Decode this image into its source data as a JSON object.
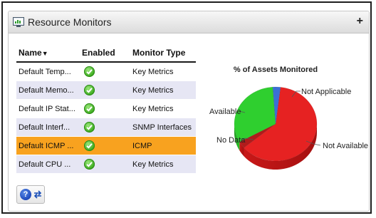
{
  "panel": {
    "title": "Resource Monitors",
    "expand_label": "+"
  },
  "table": {
    "columns": {
      "name": "Name",
      "enabled": "Enabled",
      "type": "Monitor Type"
    },
    "rows": [
      {
        "name": "Default Temp...",
        "enabled": true,
        "type": "Key Metrics",
        "state": "normal"
      },
      {
        "name": "Default Memo...",
        "enabled": true,
        "type": "Key Metrics",
        "state": "alt"
      },
      {
        "name": "Default IP Stat...",
        "enabled": true,
        "type": "Key Metrics",
        "state": "normal"
      },
      {
        "name": "Default Interf...",
        "enabled": true,
        "type": "SNMP Interfaces",
        "state": "alt"
      },
      {
        "name": "Default ICMP ...",
        "enabled": true,
        "type": "ICMP",
        "state": "selected"
      },
      {
        "name": "Default CPU ...",
        "enabled": true,
        "type": "Key Metrics",
        "state": "alt"
      }
    ]
  },
  "toolbar": {
    "help_label": "?"
  },
  "chart": {
    "title": "% of Assets Monitored",
    "labels": {
      "not_applicable": "Not Applicable",
      "available": "Available",
      "no_data": "No Data",
      "not_available": "Not Available"
    }
  },
  "chart_data": {
    "type": "pie",
    "title": "% of Assets Monitored",
    "slices": [
      {
        "label": "Not Available",
        "value": 62,
        "color": "#e62222"
      },
      {
        "label": "No Data",
        "value": 3,
        "color": "#b01b1b"
      },
      {
        "label": "Available",
        "value": 32,
        "color": "#2fcf2f"
      },
      {
        "label": "Not Applicable",
        "value": 3,
        "color": "#3b6fd6"
      }
    ]
  },
  "colors": {
    "selected_row": "#f8a21f",
    "alt_row": "#e6e6f4",
    "check_green": "#38a81a"
  }
}
